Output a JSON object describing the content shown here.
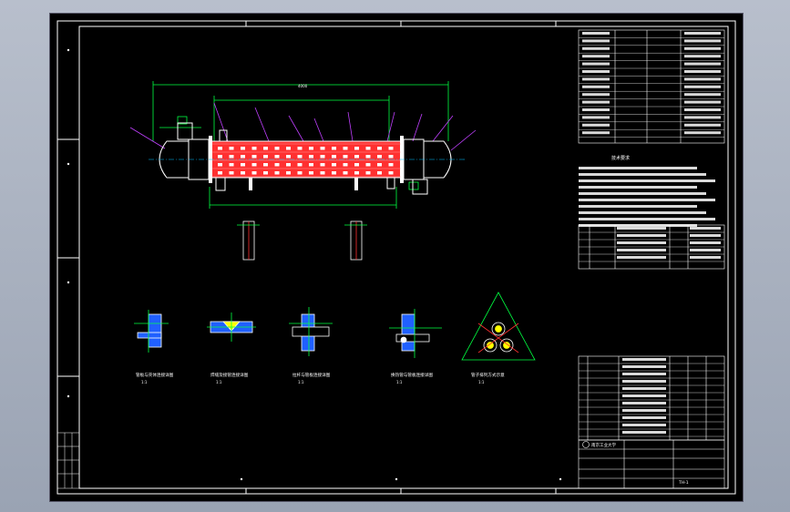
{
  "drawing": {
    "background": "#000000",
    "frame_color": "#ffffff",
    "equipment_color": "#ff3030",
    "dimension_color": "#00ff40",
    "leader_color": "#c040ff",
    "table_text_color": "#ffffff"
  },
  "section_view_labels": [
    "管板与壳体连接详图",
    "焊缝及接管连接详图",
    "拉杆与管板连接详图",
    "换热管与管板连接详图",
    "管子排列方式示意"
  ],
  "section_view_scales": [
    "1:1",
    "1:1",
    "1:1",
    "1:1",
    "1:1"
  ],
  "tech_requirements": {
    "title": "技术要求"
  },
  "title_block": {
    "school": "南京工业大学",
    "drawing_no": "TH-1"
  }
}
